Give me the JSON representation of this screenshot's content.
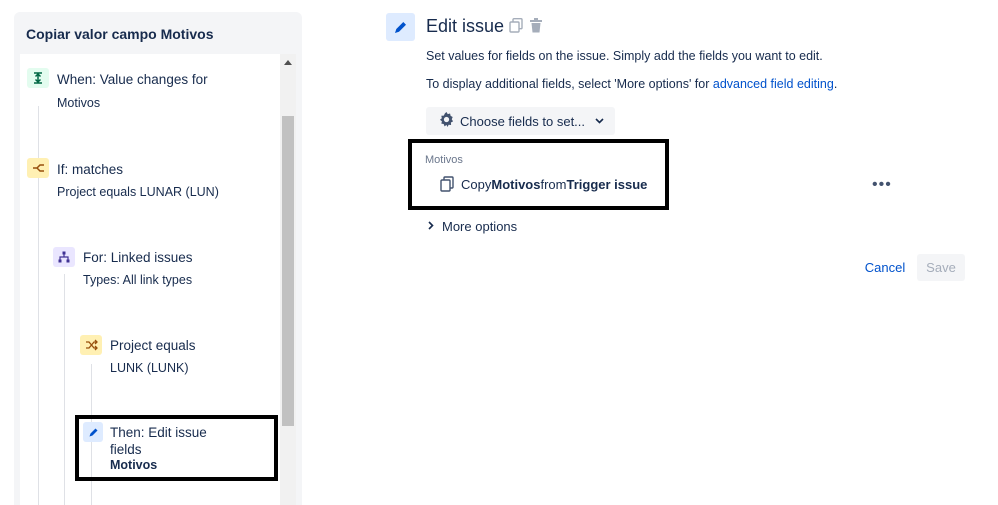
{
  "rule_panel": {
    "title": "Copiar valor campo Motivos",
    "nodes": [
      {
        "title": "When: Value changes for",
        "subtitle": "Motivos",
        "icon": "trigger-icon",
        "color": "#e3fcef"
      },
      {
        "title": "If: matches",
        "subtitle": "Project equals LUNAR (LUN)",
        "icon": "condition-branch-icon",
        "color": "#fff0b3"
      },
      {
        "title": "For: Linked issues",
        "subtitle": "Types: All link types",
        "icon": "hierarchy-icon",
        "color": "#eae6ff"
      },
      {
        "title": "Project equals",
        "subtitle": "LUNK (LUNK)",
        "icon": "shuffle-icon",
        "color": "#fff0b3"
      },
      {
        "title_line1": "Then: Edit issue",
        "title_line2": "fields",
        "bold": "Motivos",
        "icon": "pencil-icon",
        "color": "#deebff"
      }
    ]
  },
  "editor": {
    "title": "Edit issue",
    "description": "Set values for fields on the issue. Simply add the fields you want to edit.",
    "additional_prefix": "To display additional fields, select 'More options' for ",
    "additional_link": "advanced field editing",
    "additional_suffix": ".",
    "choose_fields_label": "Choose fields to set...",
    "field_label": "Motivos",
    "copy": {
      "prefix": "Copy ",
      "field": "Motivos",
      "middle": " from ",
      "source": "Trigger issue"
    },
    "more_options_label": "More options",
    "cancel_label": "Cancel",
    "save_label": "Save"
  },
  "colors": {
    "accent": "#0052cc",
    "highlight_border": "#000000"
  }
}
